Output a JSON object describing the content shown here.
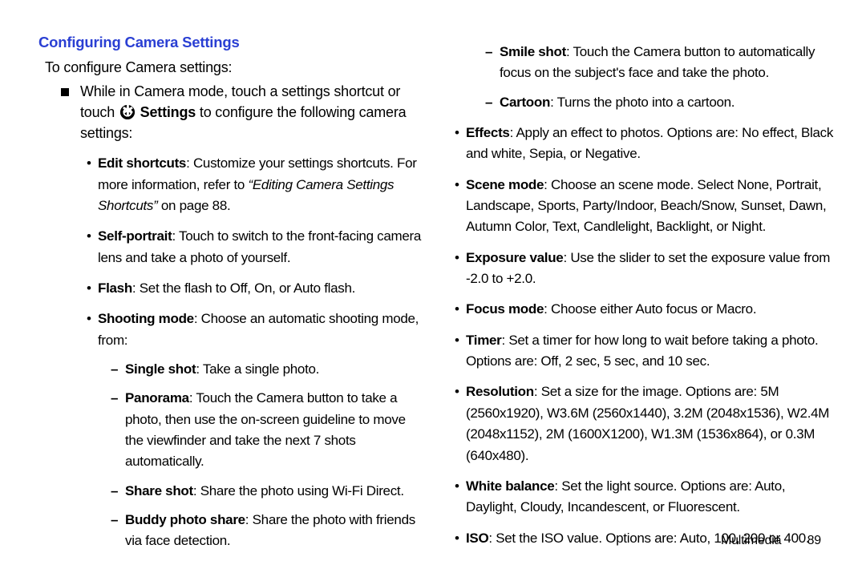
{
  "heading": "Configuring Camera Settings",
  "intro": "To configure Camera settings:",
  "step_prefix": "While in Camera mode, touch a settings shortcut or touch ",
  "step_settings_word": "Settings",
  "step_suffix": " to configure the following camera settings:",
  "left_items": [
    {
      "name": "Edit shortcuts",
      "text": ": Customize your settings shortcuts. For more information, refer to ",
      "ref": "“Editing Camera Settings Shortcuts”",
      "ref_tail": "  on page 88."
    },
    {
      "name": "Self-portrait",
      "text": ": Touch to switch to the front-facing camera lens and take a photo of yourself."
    },
    {
      "name": "Flash",
      "text": ": Set the flash to Off, On, or Auto flash."
    },
    {
      "name": "Shooting mode",
      "text": ": Choose an automatic shooting mode, from:",
      "sub": [
        {
          "name": "Single shot",
          "text": ": Take a single photo."
        },
        {
          "name": "Panorama",
          "text": ": Touch the Camera button to take a photo, then use the on-screen guideline to move the viewfinder and take the next 7 shots automatically."
        },
        {
          "name": "Share shot",
          "text": ": Share the photo using Wi-Fi Direct."
        },
        {
          "name": "Buddy photo share",
          "text": ": Share the photo with friends via face detection."
        }
      ]
    }
  ],
  "right_top_sub": [
    {
      "name": "Smile shot",
      "text": ": Touch the Camera button to automatically focus on the subject's face and take the photo."
    },
    {
      "name": "Cartoon",
      "text": ": Turns the photo into a cartoon."
    }
  ],
  "right_items": [
    {
      "name": "Effects",
      "text": ": Apply an effect to photos. Options are: No effect, Black and white, Sepia, or Negative."
    },
    {
      "name": "Scene mode",
      "text": ": Choose an scene mode. Select None, Portrait, Landscape, Sports, Party/Indoor, Beach/Snow, Sunset, Dawn, Autumn Color, Text, Candlelight, Backlight, or Night."
    },
    {
      "name": "Exposure value",
      "text": ": Use the slider to set the exposure value from -2.0 to +2.0."
    },
    {
      "name": "Focus mode",
      "text": ": Choose either Auto focus or Macro."
    },
    {
      "name": "Timer",
      "text": ": Set a timer for how long to wait before taking a photo. Options are: Off, 2 sec, 5 sec, and 10 sec."
    },
    {
      "name": "Resolution",
      "text": ": Set a size for the image. Options are: 5M (2560x1920), W3.6M (2560x1440), 3.2M (2048x1536), W2.4M (2048x1152), 2M (1600X1200), W1.3M (1536x864), or 0.3M (640x480)."
    },
    {
      "name": "White balance",
      "text": ": Set the light source. Options are: Auto, Daylight, Cloudy, Incandescent, or Fluorescent."
    },
    {
      "name": "ISO",
      "text": ": Set the ISO value. Options are: Auto, 100, 200 or 400."
    }
  ],
  "footer_section": "Multimedia",
  "footer_page": "89"
}
